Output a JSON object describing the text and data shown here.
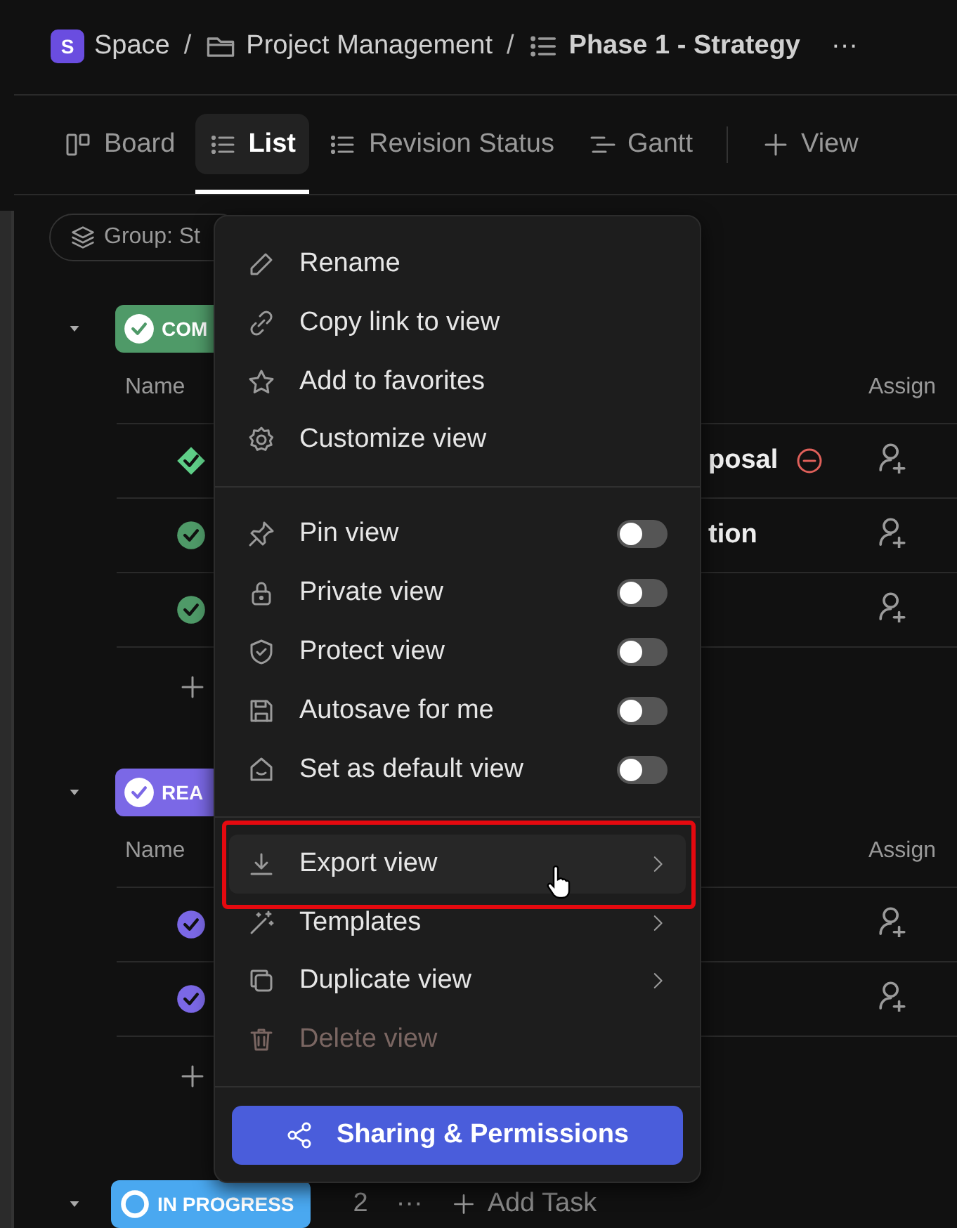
{
  "breadcrumbs": [
    {
      "kind": "space",
      "avatar": "S",
      "label": "Space"
    },
    {
      "kind": "folder",
      "separator": "/",
      "label": "Project Management"
    },
    {
      "kind": "list",
      "separator": "/",
      "label": "Phase 1 - Strategy"
    }
  ],
  "more": "···",
  "tabs": [
    {
      "kind": "board",
      "label": "Board",
      "selected": false
    },
    {
      "kind": "list",
      "label": "List",
      "selected": true
    },
    {
      "kind": "list",
      "label": "Revision Status",
      "selected": false
    },
    {
      "kind": "gantt",
      "label": "Gantt",
      "selected": false
    }
  ],
  "add_view": "View",
  "group_by": "Group: St",
  "groups": [
    {
      "label": "COM",
      "color": "#4f9a68",
      "columns": [
        "Name",
        "Assign"
      ],
      "tasks": [
        {
          "kind": "milestone",
          "name": "posal",
          "blocked": true
        },
        {
          "kind": "task",
          "name": "tion",
          "blocked": false
        },
        {
          "kind": "task",
          "blocked": false
        }
      ]
    },
    {
      "label": "REA",
      "color": "#7b68e6",
      "columns": [
        "Name",
        "Assign"
      ],
      "tasks": [
        {
          "kind": "task",
          "blocked": false
        },
        {
          "kind": "task",
          "blocked": false
        }
      ]
    }
  ],
  "last_group": {
    "label": "IN PROGRESS",
    "color": "#4aa8f0",
    "count": "2",
    "more": "···",
    "add": "Add Task"
  },
  "menu": {
    "sections": [
      [
        {
          "kind": "action",
          "label": "Rename"
        },
        {
          "kind": "action",
          "label": "Copy link to view"
        },
        {
          "kind": "action",
          "label": "Add to favorites"
        },
        {
          "kind": "action",
          "label": "Customize view"
        }
      ],
      [
        {
          "kind": "toggle",
          "label": "Pin view",
          "on": false
        },
        {
          "kind": "toggle",
          "label": "Private view",
          "on": false
        },
        {
          "kind": "toggle",
          "label": "Protect view",
          "on": false
        },
        {
          "kind": "toggle",
          "label": "Autosave for me",
          "on": false
        },
        {
          "kind": "toggle",
          "label": "Set as default view",
          "on": false
        }
      ],
      [
        {
          "kind": "submenu",
          "label": "Export view",
          "highlighted": true
        },
        {
          "kind": "submenu",
          "label": "Templates",
          "highlighted": false
        },
        {
          "kind": "submenu",
          "label": "Duplicate view",
          "highlighted": false
        },
        {
          "kind": "action",
          "label": "Delete view",
          "disabled": true
        }
      ]
    ],
    "button": "Sharing & Permissions"
  }
}
